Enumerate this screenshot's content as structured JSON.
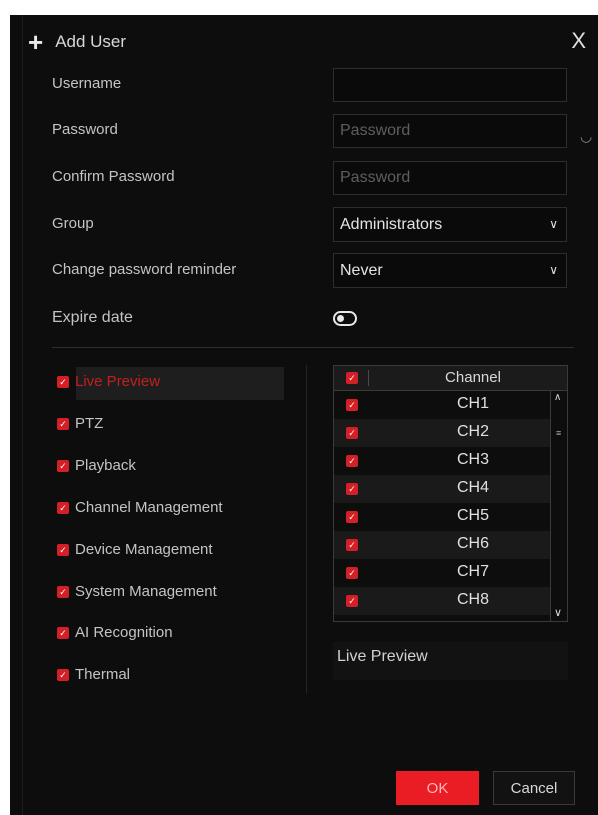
{
  "dialog": {
    "title_icon": "plus-icon",
    "title": "Add User",
    "close_label": "X"
  },
  "form": {
    "username_label": "Username",
    "username_value": "",
    "password_label": "Password",
    "password_placeholder": "Password",
    "confirm_label": "Confirm Password",
    "confirm_placeholder": "Password",
    "group_label": "Group",
    "group_value": "Administrators",
    "reminder_label": "Change password reminder",
    "reminder_value": "Never",
    "expire_label": "Expire date",
    "expire_enabled": false
  },
  "permissions": [
    {
      "label": "Live Preview",
      "checked": true,
      "selected": true
    },
    {
      "label": "PTZ",
      "checked": true
    },
    {
      "label": "Playback",
      "checked": true
    },
    {
      "label": "Channel Management",
      "checked": true
    },
    {
      "label": "Device Management",
      "checked": true
    },
    {
      "label": "System Management",
      "checked": true
    },
    {
      "label": "AI Recognition",
      "checked": true
    },
    {
      "label": "Thermal",
      "checked": true
    }
  ],
  "channels": {
    "header": "Channel",
    "rows": [
      "CH1",
      "CH2",
      "CH3",
      "CH4",
      "CH5",
      "CH6",
      "CH7",
      "CH8"
    ]
  },
  "selected_permission": "Live Preview",
  "buttons": {
    "ok": "OK",
    "cancel": "Cancel"
  },
  "colors": {
    "accent": "#ea1c24",
    "background": "#0d0d0d"
  }
}
